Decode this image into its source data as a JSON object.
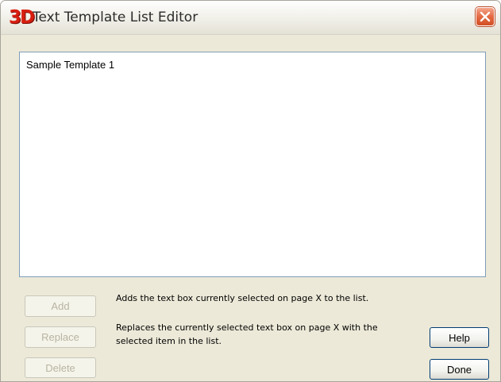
{
  "window": {
    "logo": "3D",
    "title": "Text Template List Editor",
    "close_icon": "close-x-icon"
  },
  "template_list": {
    "items": [
      "Sample Template 1"
    ]
  },
  "actions": {
    "add": {
      "label": "Add",
      "enabled": false,
      "description": "Adds the text box currently selected on page X to the list."
    },
    "replace": {
      "label": "Replace",
      "enabled": false,
      "description_line1": "Replaces the currently selected text box on page X with the",
      "description_line2": "selected item in the list."
    },
    "delete": {
      "label": "Delete",
      "enabled": false
    }
  },
  "footer": {
    "help_label": "Help",
    "done_label": "Done"
  },
  "colors": {
    "dialog_background": "#ece9d8",
    "logo_red": "#d81e10",
    "close_button": "#e46a43",
    "list_border": "#7f9db9",
    "button_border": "#003c74"
  }
}
